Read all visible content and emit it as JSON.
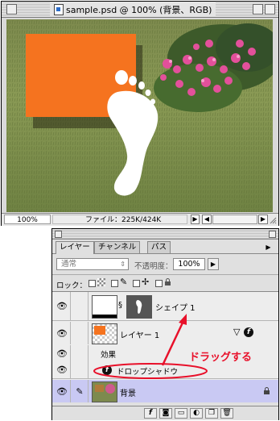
{
  "document": {
    "title": "sample.psd @ 100% (背景、RGB)",
    "zoom": "100%",
    "file_size": "ファイル：225K/424K"
  },
  "palette": {
    "tabs": [
      "レイヤー",
      "チャンネル",
      "パス"
    ],
    "blend_mode": "通常",
    "opacity_label": "不透明度：",
    "opacity_value": "100%",
    "lock_label": "ロック：",
    "layers": {
      "shape": "シェイプ 1",
      "layer1": "レイヤー 1",
      "effects": "効果",
      "drop_shadow": "ドロップシャドウ",
      "background": "背景"
    }
  },
  "annotation": {
    "text": "ドラッグする",
    "color": "#e8102a"
  },
  "colors": {
    "orange_fill": "#f5731f",
    "selected_row": "#c9c9f3"
  }
}
